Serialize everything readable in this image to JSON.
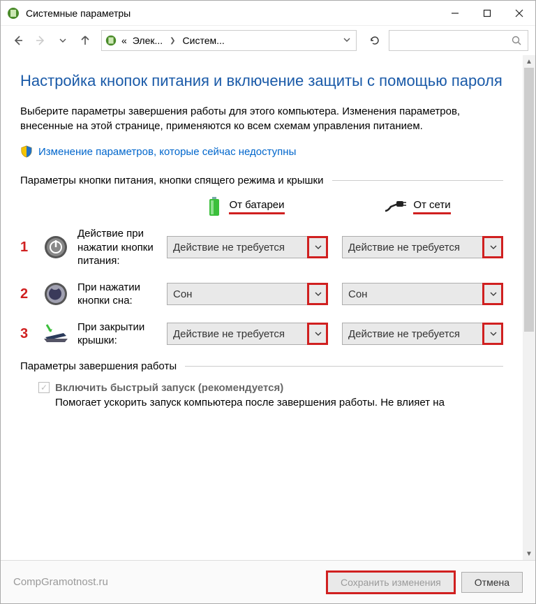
{
  "window": {
    "title": "Системные параметры"
  },
  "breadcrumb": {
    "prefix": "«",
    "seg1": "Элек...",
    "seg2": "Систем..."
  },
  "page": {
    "heading": "Настройка кнопок питания и включение защиты с помощью пароля",
    "description": "Выберите параметры завершения работы для этого компьютера. Изменения параметров, внесенные на этой странице, применяются ко всем схемам управления питанием.",
    "shield_link": "Изменение параметров, которые сейчас недоступны"
  },
  "section1": {
    "title": "Параметры кнопки питания, кнопки спящего режима и крышки",
    "col_battery": "От батареи",
    "col_ac": "От сети",
    "rows": [
      {
        "num": "1",
        "label": "Действие при нажатии кнопки питания:",
        "battery": "Действие не требуется",
        "ac": "Действие не требуется"
      },
      {
        "num": "2",
        "label": "При нажатии кнопки сна:",
        "battery": "Сон",
        "ac": "Сон"
      },
      {
        "num": "3",
        "label": "При закрытии крышки:",
        "battery": "Действие не требуется",
        "ac": "Действие не требуется"
      }
    ]
  },
  "section2": {
    "title": "Параметры завершения работы",
    "fastboot_label": "Включить быстрый запуск (рекомендуется)",
    "fastboot_help": "Помогает ускорить запуск компьютера после завершения работы. Не влияет на"
  },
  "footer": {
    "attribution": "CompGramotnost.ru",
    "save": "Сохранить изменения",
    "cancel": "Отмена"
  }
}
